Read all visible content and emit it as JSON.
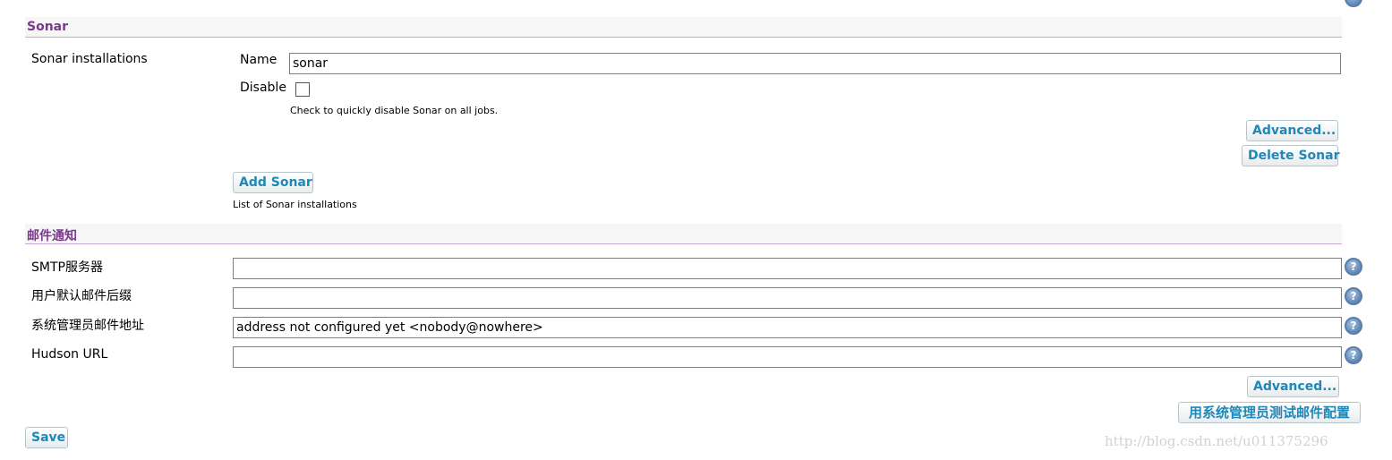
{
  "sonar_section": {
    "title": "Sonar",
    "installations_label": "Sonar installations",
    "name_label": "Name",
    "name_value": "sonar",
    "disable_label": "Disable",
    "disable_checked": false,
    "disable_help": "Check to quickly disable Sonar on all jobs.",
    "advanced_button": "Advanced...",
    "delete_button": "Delete Sonar",
    "add_button": "Add Sonar",
    "list_help": "List of Sonar installations"
  },
  "email_section": {
    "title": "邮件通知",
    "fields": [
      {
        "label": "SMTP服务器",
        "value": ""
      },
      {
        "label": "用户默认邮件后缀",
        "value": ""
      },
      {
        "label": "系统管理员邮件地址",
        "value": "address not configured yet <nobody@nowhere>"
      },
      {
        "label": "Hudson URL",
        "value": ""
      }
    ],
    "help_glyph": "?",
    "advanced_button": "Advanced...",
    "test_button": "用系统管理员测试邮件配置"
  },
  "save_button": "Save",
  "watermark": "http://blog.csdn.net/u011375296",
  "colors": {
    "section_title": "#7a3a8c",
    "button_text": "#1e88b8",
    "divider": "#c9a8d9"
  },
  "icons": {
    "help": "help-circle-icon"
  }
}
